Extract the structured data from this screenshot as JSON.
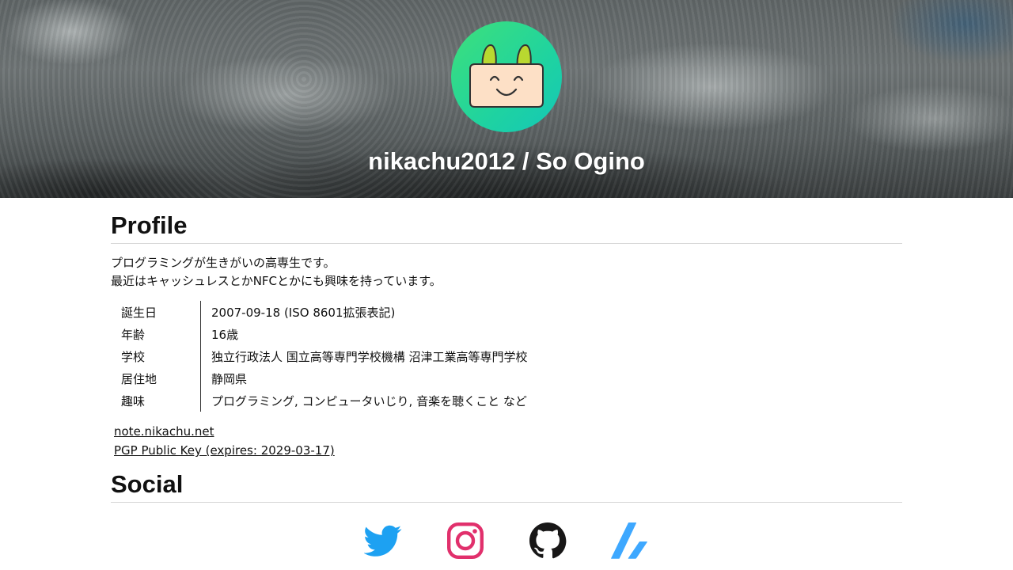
{
  "header": {
    "title": "nikachu2012 / So Ogino",
    "avatar_icon": "smiling-box-character"
  },
  "profile": {
    "heading": "Profile",
    "intro_lines": [
      "プログラミングが生きがいの高専生です。",
      "最近はキャッシュレスとかNFCとかにも興味を持っています。"
    ],
    "rows": [
      {
        "key": "誕生日",
        "value": "2007-09-18 (ISO 8601拡張表記)"
      },
      {
        "key": "年齢",
        "value": "16歳"
      },
      {
        "key": "学校",
        "value": "独立行政法人 国立高等専門学校機構 沼津工業高等専門学校"
      },
      {
        "key": "居住地",
        "value": "静岡県"
      },
      {
        "key": "趣味",
        "value": "プログラミング, コンピュータいじり, 音楽を聴くこと など"
      }
    ],
    "links": [
      {
        "label": "note.nikachu.net"
      },
      {
        "label": "PGP Public Key (expires: 2029-03-17)"
      }
    ]
  },
  "social": {
    "heading": "Social",
    "icons": [
      {
        "name": "twitter-icon",
        "color": "#1da1f2"
      },
      {
        "name": "instagram-icon",
        "color": "#e1306c"
      },
      {
        "name": "github-icon",
        "color": "#181717"
      },
      {
        "name": "zenn-icon",
        "color": "#3ea8ff"
      }
    ]
  }
}
